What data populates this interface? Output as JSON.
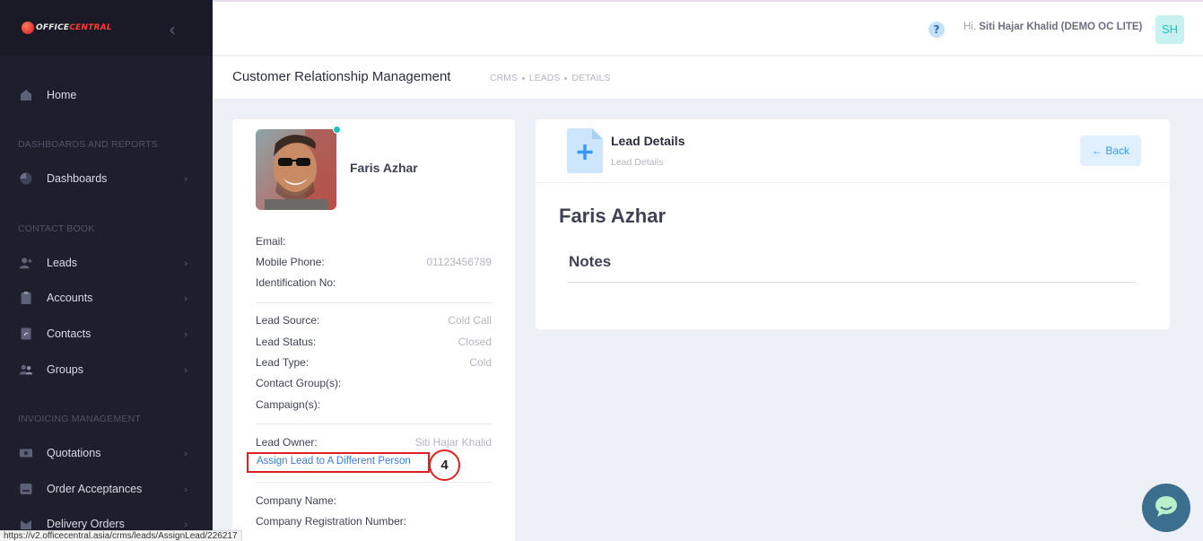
{
  "brand": {
    "logo_prefix": "OFFICE",
    "logo_suffix": "CENTRAL",
    "accent": "#ff3b30"
  },
  "sidebar": {
    "items": [
      {
        "label": "Home",
        "icon": "home-icon"
      },
      {
        "section": "DASHBOARDS AND REPORTS"
      },
      {
        "label": "Dashboards",
        "icon": "pie-chart-icon"
      },
      {
        "section": "CONTACT BOOK"
      },
      {
        "label": "Leads",
        "icon": "add-user-icon"
      },
      {
        "label": "Accounts",
        "icon": "clipboard-icon"
      },
      {
        "label": "Contacts",
        "icon": "address-book-icon"
      },
      {
        "label": "Groups",
        "icon": "group-icon"
      },
      {
        "section": "INVOICING MANAGEMENT"
      },
      {
        "label": "Quotations",
        "icon": "money-icon"
      },
      {
        "label": "Order Acceptances",
        "icon": "inbox-icon"
      },
      {
        "label": "Delivery Orders",
        "icon": "delivery-icon"
      }
    ]
  },
  "topbar": {
    "help": "?",
    "greeting_prefix": "Hi,",
    "user_name": "Siti Hajar Khalid (DEMO OC LITE)",
    "avatar_initials": "SH"
  },
  "subheader": {
    "title": "Customer Relationship Management",
    "breadcrumbs": [
      "CRMS",
      "LEADS",
      "DETAILS"
    ]
  },
  "profile": {
    "name": "Faris Azhar",
    "fields_1": [
      {
        "label": "Email:",
        "value": ""
      },
      {
        "label": "Mobile Phone:",
        "value": "01123456789"
      },
      {
        "label": "Identification No:",
        "value": ""
      }
    ],
    "fields_2": [
      {
        "label": "Lead Source:",
        "value": "Cold Call"
      },
      {
        "label": "Lead Status:",
        "value": "Closed"
      },
      {
        "label": "Lead Type:",
        "value": "Cold"
      },
      {
        "label": "Contact Group(s):",
        "value": ""
      },
      {
        "label": "Campaign(s):",
        "value": ""
      }
    ],
    "lead_owner": {
      "label": "Lead Owner:",
      "value": "Siti Hajar Khalid"
    },
    "assign_link": "Assign Lead to A Different Person",
    "step_marker": "4",
    "fields_3": [
      {
        "label": "Company Name:",
        "value": ""
      },
      {
        "label": "Company Registration Number:",
        "value": ""
      }
    ]
  },
  "lead_details": {
    "title": "Lead Details",
    "subtitle": "Lead Details",
    "back_label": "← Back",
    "lead_name": "Faris Azhar",
    "notes_heading": "Notes"
  },
  "status_bar": {
    "url": "https://v2.officecentral.asia/crms/leads/AssignLead/226217"
  }
}
